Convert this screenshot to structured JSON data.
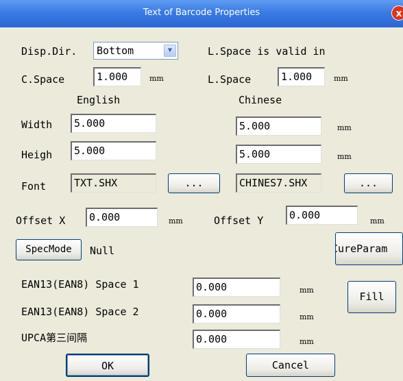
{
  "window": {
    "title": "Text of Barcode Properties",
    "close_glyph": "x"
  },
  "disp_dir": {
    "label": "Disp.Dir.",
    "value": "Bottom",
    "note": "L.Space is valid in"
  },
  "spacing": {
    "c_label": "C.Space",
    "c_value": "1.000",
    "l_label": "L.Space",
    "l_value": "1.000",
    "unit": "mm"
  },
  "columns": {
    "english": "English",
    "chinese": "Chinese"
  },
  "width": {
    "label": "Width",
    "english": "5.000",
    "chinese": "5.000",
    "unit": "mm"
  },
  "height": {
    "label": "Heigh",
    "english": "5.000",
    "chinese": "5.000",
    "unit": "mm"
  },
  "font": {
    "label": "Font",
    "english": "TXT.SHX",
    "chinese": "CHINES7.SHX",
    "browse": "..."
  },
  "offset": {
    "x_label": "Offset X",
    "x_value": "0.000",
    "y_label": "Offset Y",
    "y_value": "0.000",
    "unit": "mm"
  },
  "spec": {
    "button": "SpecMode",
    "value": "Null",
    "cure_button": "CureParam"
  },
  "ean_space1": {
    "label": "EAN13(EAN8) Space 1",
    "value": "0.000",
    "unit": "mm"
  },
  "ean_space2": {
    "label": "EAN13(EAN8) Space 2",
    "value": "0.000",
    "unit": "mm"
  },
  "upca": {
    "label": "UPCA第三间隔",
    "value": "0.000",
    "unit": "mm"
  },
  "fill_button": "Fill",
  "ok_button": "OK",
  "cancel_button": "Cancel"
}
